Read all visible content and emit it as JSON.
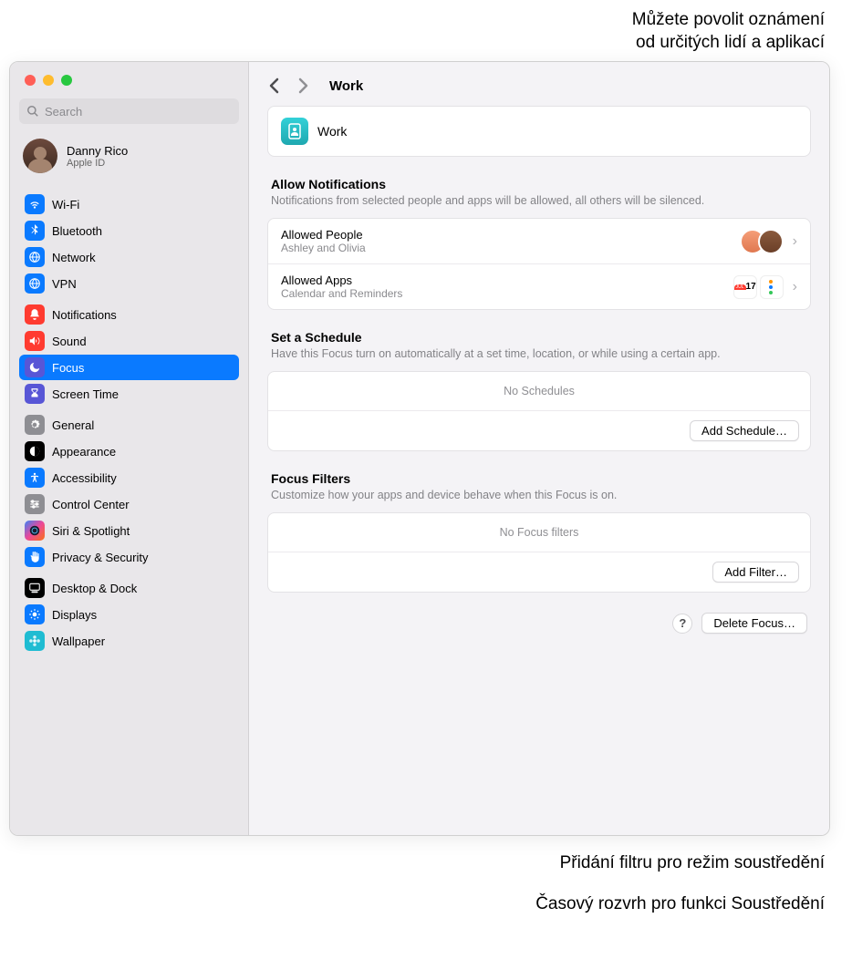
{
  "annotations": {
    "top1": "Můžete povolit oznámení",
    "top2": "od určitých lidí a aplikací",
    "bottom1": "Přidání filtru pro režim soustředění",
    "bottom2": "Časový rozvrh pro funkci Soustředění"
  },
  "search": {
    "placeholder": "Search"
  },
  "account": {
    "name": "Danny Rico",
    "sub": "Apple ID"
  },
  "sidebar": {
    "groups": [
      [
        {
          "label": "Wi-Fi",
          "color": "#0a7aff",
          "icon": "wifi"
        },
        {
          "label": "Bluetooth",
          "color": "#0a7aff",
          "icon": "bluetooth"
        },
        {
          "label": "Network",
          "color": "#0a7aff",
          "icon": "globe"
        },
        {
          "label": "VPN",
          "color": "#0a7aff",
          "icon": "globe"
        }
      ],
      [
        {
          "label": "Notifications",
          "color": "#ff3b30",
          "icon": "bell"
        },
        {
          "label": "Sound",
          "color": "#ff3b30",
          "icon": "speaker"
        },
        {
          "label": "Focus",
          "color": "#5856d6",
          "icon": "moon",
          "active": true
        },
        {
          "label": "Screen Time",
          "color": "#5856d6",
          "icon": "hourglass"
        }
      ],
      [
        {
          "label": "General",
          "color": "#8e8e93",
          "icon": "gear"
        },
        {
          "label": "Appearance",
          "color": "#000000",
          "icon": "appearance"
        },
        {
          "label": "Accessibility",
          "color": "#0a7aff",
          "icon": "access"
        },
        {
          "label": "Control Center",
          "color": "#8e8e93",
          "icon": "sliders"
        },
        {
          "label": "Siri & Spotlight",
          "color": "linear-gradient(135deg,#3b82f6,#ec4899,#f97316)",
          "icon": "siri"
        },
        {
          "label": "Privacy & Security",
          "color": "#0a7aff",
          "icon": "hand"
        }
      ],
      [
        {
          "label": "Desktop & Dock",
          "color": "#000000",
          "icon": "dock"
        },
        {
          "label": "Displays",
          "color": "#0a7aff",
          "icon": "sun"
        },
        {
          "label": "Wallpaper",
          "color": "#1fbcd2",
          "icon": "flower"
        }
      ]
    ]
  },
  "header": {
    "title": "Work"
  },
  "focus": {
    "name": "Work"
  },
  "sections": {
    "allow": {
      "title": "Allow Notifications",
      "sub": "Notifications from selected people and apps will be allowed, all others will be silenced.",
      "people": {
        "title": "Allowed People",
        "sub": "Ashley and Olivia"
      },
      "apps": {
        "title": "Allowed Apps",
        "sub": "Calendar and Reminders"
      }
    },
    "schedule": {
      "title": "Set a Schedule",
      "sub": "Have this Focus turn on automatically at a set time, location, or while using a certain app.",
      "empty": "No Schedules",
      "button": "Add Schedule…"
    },
    "filters": {
      "title": "Focus Filters",
      "sub": "Customize how your apps and device behave when this Focus is on.",
      "empty": "No Focus filters",
      "button": "Add Filter…"
    },
    "delete": "Delete Focus…"
  }
}
